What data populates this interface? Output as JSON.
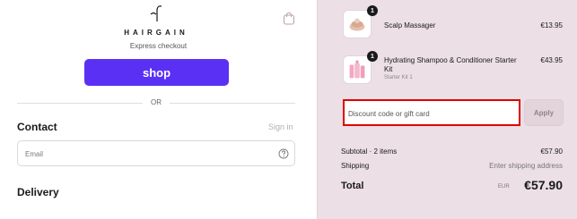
{
  "header": {
    "brand": "HAIRGAIN",
    "logo_icon": "hairgain-logo-icon",
    "cart_icon": "shopping-bag-icon"
  },
  "express": {
    "label": "Express checkout",
    "shop_button_label": "shop",
    "shop_button_color": "#5a31f4"
  },
  "divider": {
    "or_label": "OR"
  },
  "contact": {
    "heading": "Contact",
    "signin_label": "Sign in",
    "email_placeholder": "Email",
    "help_icon": "question-circle-icon"
  },
  "delivery": {
    "heading": "Delivery"
  },
  "order": {
    "items": [
      {
        "quantity": "1",
        "name": "Scalp Massager",
        "variant": "",
        "price": "€13.95"
      },
      {
        "quantity": "1",
        "name": "Hydrating Shampoo & Conditioner Starter Kit",
        "variant": "Starter Kit 1",
        "price": "€43.95"
      }
    ],
    "discount": {
      "placeholder": "Discount code or gift card",
      "apply_label": "Apply",
      "highlight_color": "#e00000"
    },
    "summary": {
      "subtotal_label": "Subtotal · 2 items",
      "subtotal_value": "€57.90",
      "shipping_label": "Shipping",
      "shipping_value": "Enter shipping address",
      "total_label": "Total",
      "currency": "EUR",
      "total_value": "€57.90"
    },
    "panel_color": "#ecdfe6"
  }
}
